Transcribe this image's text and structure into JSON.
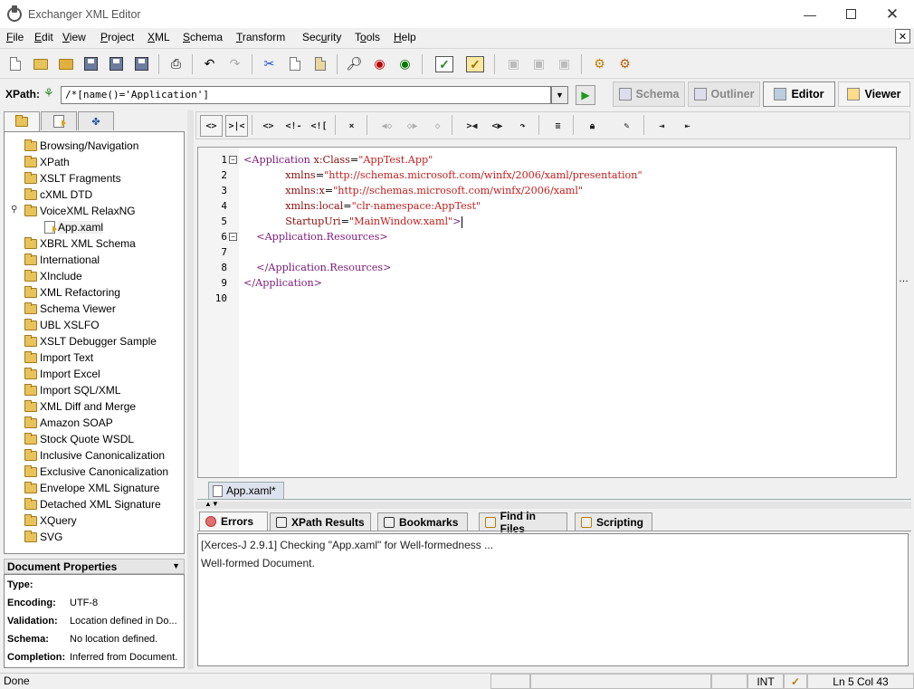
{
  "window": {
    "title": "Exchanger XML Editor"
  },
  "menu": [
    {
      "pre": "",
      "u": "F",
      "post": "ile"
    },
    {
      "pre": "",
      "u": "E",
      "post": "dit"
    },
    {
      "pre": "",
      "u": "V",
      "post": "iew"
    },
    {
      "pre": "",
      "u": "P",
      "post": "roject"
    },
    {
      "pre": "",
      "u": "X",
      "post": "ML"
    },
    {
      "pre": "",
      "u": "S",
      "post": "chema"
    },
    {
      "pre": "",
      "u": "T",
      "post": "ransform"
    },
    {
      "pre": "Sec",
      "u": "u",
      "post": "rity"
    },
    {
      "pre": "T",
      "u": "o",
      "post": "ols"
    },
    {
      "pre": "",
      "u": "H",
      "post": "elp"
    }
  ],
  "xpath": {
    "label": "XPath:",
    "value": "/*[name()='Application']"
  },
  "views": {
    "schema": "Schema",
    "outliner": "Outliner",
    "editor": "Editor",
    "viewer": "Viewer"
  },
  "tree": {
    "items": [
      "Browsing/Navigation",
      "XPath",
      "XSLT Fragments",
      "cXML DTD",
      "VoiceXML RelaxNG",
      "App.xaml",
      "XBRL XML Schema",
      "International",
      "XInclude",
      "XML Refactoring",
      "Schema Viewer",
      "UBL XSLFO",
      "XSLT Debugger Sample",
      "Import Text",
      "Import Excel",
      "Import SQL/XML",
      "XML Diff and Merge",
      "Amazon SOAP",
      "Stock Quote WSDL",
      "Inclusive Canonicalization",
      "Exclusive Canonicalization",
      "Envelope XML Signature",
      "Detached XML Signature",
      "XQuery",
      "SVG"
    ]
  },
  "doc_props": {
    "header": "Document Properties",
    "rows": [
      {
        "k": "Type:",
        "v": ""
      },
      {
        "k": "Encoding:",
        "v": "UTF-8"
      },
      {
        "k": "Validation:",
        "v": "Location defined in Do..."
      },
      {
        "k": "Schema:",
        "v": "No location defined."
      },
      {
        "k": "Completion:",
        "v": "Inferred from Document."
      }
    ]
  },
  "editor": {
    "line_numbers": [
      "1",
      "2",
      "3",
      "4",
      "5",
      "6",
      "7",
      "8",
      "9",
      "10"
    ],
    "lines": [
      {
        "p1": "<Application ",
        "a1": "x:Class",
        "e": "=",
        "v1": "\"AppTest.App\""
      },
      {
        "p1": "             ",
        "a1": "xmlns",
        "e": "=",
        "v1": "\"http://schemas.microsoft.com/winfx/2006/xaml/presentation\""
      },
      {
        "p1": "             ",
        "a1": "xmlns:x",
        "e": "=",
        "v1": "\"http://schemas.microsoft.com/winfx/2006/xaml\""
      },
      {
        "p1": "             ",
        "a1": "xmlns:local",
        "e": "=",
        "v1": "\"clr-namespace:AppTest\""
      },
      {
        "p1": "             ",
        "a1": "StartupUri",
        "e": "=",
        "v1": "\"MainWindow.xaml\"",
        "end": ">"
      },
      {
        "p1": "    <Application.Resources>"
      },
      {
        "p1": ""
      },
      {
        "p1": "    </Application.Resources>"
      },
      {
        "p1": "</Application>"
      },
      {
        "p1": ""
      }
    ],
    "file_tab": "App.xaml*"
  },
  "bottom_tabs": [
    "Errors",
    "XPath Results",
    "Bookmarks",
    "Find in Files",
    "Scripting"
  ],
  "output": [
    "[Xerces-J 2.9.1] Checking \"App.xaml\" for Well-formedness ...",
    "Well-formed Document."
  ],
  "status": {
    "text": "Done",
    "mode": "INT",
    "position": "Ln 5 Col 43"
  }
}
